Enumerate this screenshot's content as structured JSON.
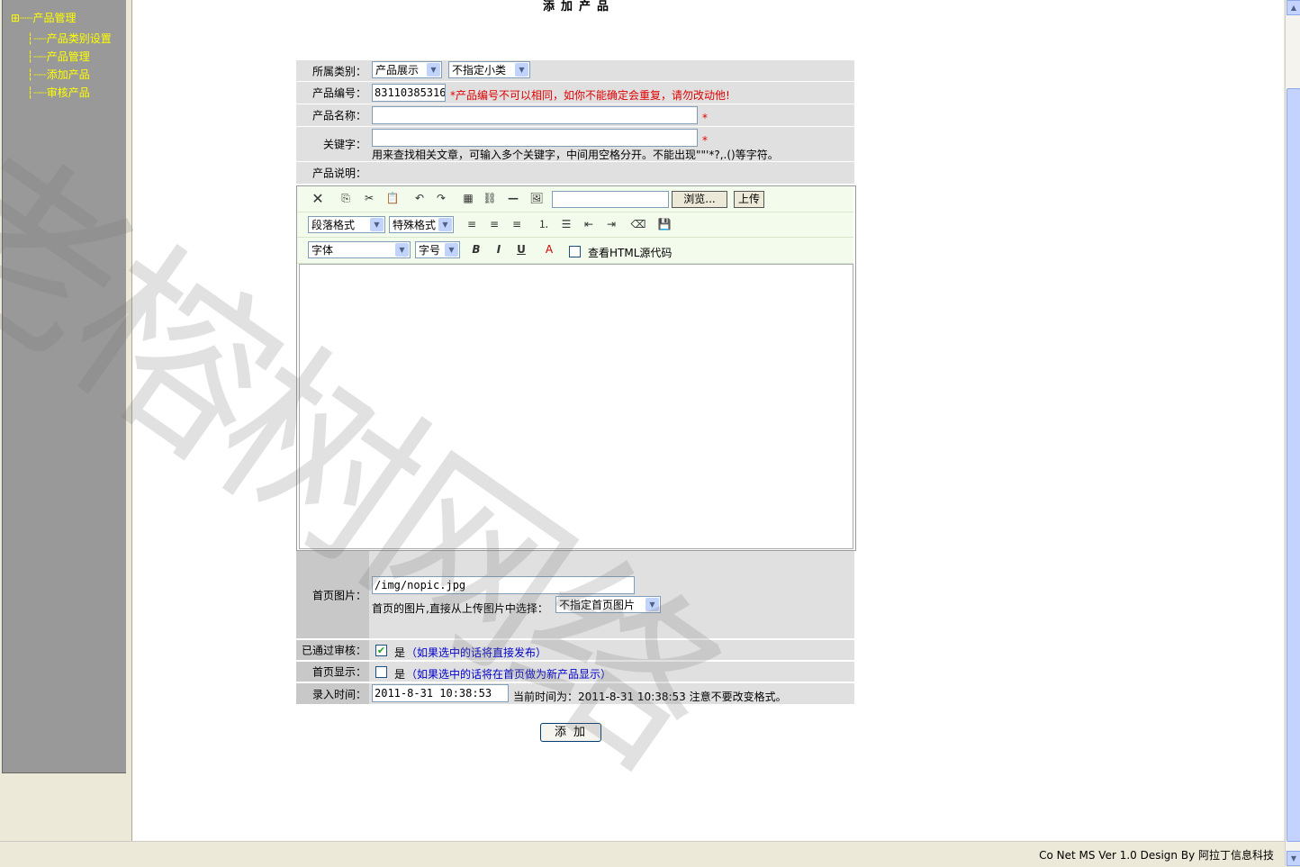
{
  "page_title": "添加产品",
  "sidebar": {
    "items": [
      {
        "label": "产品管理",
        "prefix": "⊞┈┈"
      },
      {
        "label": "产品类别设置",
        "prefix": "┆┈┈"
      },
      {
        "label": "产品管理",
        "prefix": "┆┈┈"
      },
      {
        "label": "添加产品",
        "prefix": "┆┈┈"
      },
      {
        "label": "审核产品",
        "prefix": "┆┈┈"
      }
    ]
  },
  "form": {
    "category_label": "所属类别：",
    "category_value": "产品展示",
    "subcategory_value": "不指定小类",
    "code_label": "产品编号：",
    "code_value": "83110385316",
    "code_warning": "*产品编号不可以相同，如你不能确定会重复，请勿改动他!",
    "name_label": "产品名称：",
    "name_value": "",
    "required_mark": "*",
    "keyword_label": "关键字：",
    "keyword_value": "",
    "keyword_hint": "用来查找相关文章，可输入多个关键字，中间用空格分开。不能出现\"\"'*?,.()等字符。",
    "desc_label": "产品说明：",
    "image_label": "首页图片：",
    "image_value": "/img/nopic.jpg",
    "image_hint": "首页的图片,直接从上传图片中选择：",
    "image_select": "不指定首页图片",
    "approved_label": "已通过审核：",
    "approved_text": "是",
    "approved_hint": "（如果选中的话将直接发布）",
    "home_label": "首页显示：",
    "home_text": "是",
    "home_hint": "（如果选中的话将在首页做为新产品显示）",
    "time_label": "录入时间：",
    "time_value": "2011-8-31 10:38:53",
    "time_hint": "当前时间为：2011-8-31 10:38:53 注意不要改变格式。",
    "submit_label": "添加"
  },
  "editor": {
    "browse_label": "浏览...",
    "upload_label": "上传",
    "upload_value": "",
    "paragraph_select": "段落格式",
    "special_select": "特殊格式",
    "font_select": "字体",
    "size_select": "字号",
    "bold": "B",
    "italic": "I",
    "underline": "U",
    "html_source_label": "查看HTML源代码",
    "icons": [
      "delete-icon",
      "copy-icon",
      "cut-icon",
      "paste-icon",
      "undo-icon",
      "redo-icon",
      "table-icon",
      "link-icon",
      "hr-icon",
      "image-icon",
      "align-left-icon",
      "align-center-icon",
      "align-right-icon",
      "ordered-list-icon",
      "unordered-list-icon",
      "outdent-icon",
      "indent-icon",
      "clean-icon",
      "save-icon",
      "bold-icon",
      "italic-icon",
      "underline-icon",
      "color-icon"
    ]
  },
  "footer": {
    "text": "Co Net MS Ver 1.0   Design By 阿拉丁信息科技"
  },
  "watermark": "老榕树网络"
}
